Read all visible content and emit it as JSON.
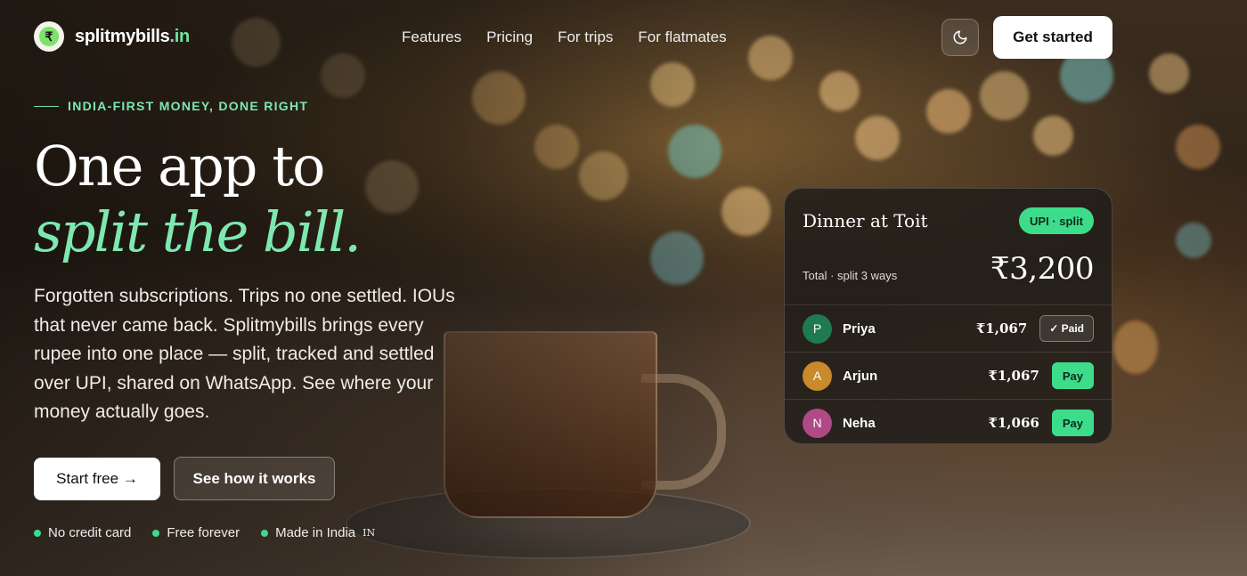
{
  "brand": {
    "name": "splitmybills",
    "tld": ".in",
    "mark": "₹"
  },
  "nav": {
    "links": [
      "Features",
      "Pricing",
      "For trips",
      "For flatmates"
    ],
    "cta": "Get started"
  },
  "hero": {
    "eyebrow": "INDIA-FIRST MONEY, DONE RIGHT",
    "title_line1": "One app to",
    "title_line2": "split the bill.",
    "subtitle": "Forgotten subscriptions. Trips no one settled. IOUs that never came back. Splitmybills brings every rupee into one place — split, tracked and settled over UPI, shared on WhatsApp. See where your money actually goes.",
    "primary_cta": "Start free →",
    "secondary_cta": "See how it works",
    "perks": [
      "No credit card",
      "Free forever",
      "Made in India"
    ],
    "perk_flag": "IN"
  },
  "card": {
    "title": "Dinner at Toit",
    "badge": "UPI · split",
    "total_label": "Total · split 3 ways",
    "total_value": "₹3,200",
    "rows": [
      {
        "initial": "P",
        "name": "Priya",
        "amount": "₹1,067",
        "status": "✓ Paid",
        "avatar_color": "#1f7a4f"
      },
      {
        "initial": "A",
        "name": "Arjun",
        "amount": "₹1,067",
        "status": "Pay",
        "avatar_color": "#c88a2a"
      },
      {
        "initial": "N",
        "name": "Neha",
        "amount": "₹1,066",
        "status": "Pay",
        "avatar_color": "#b04a86"
      }
    ]
  },
  "colors": {
    "accent": "#7ee8b0",
    "pay": "#3ddc8a"
  }
}
